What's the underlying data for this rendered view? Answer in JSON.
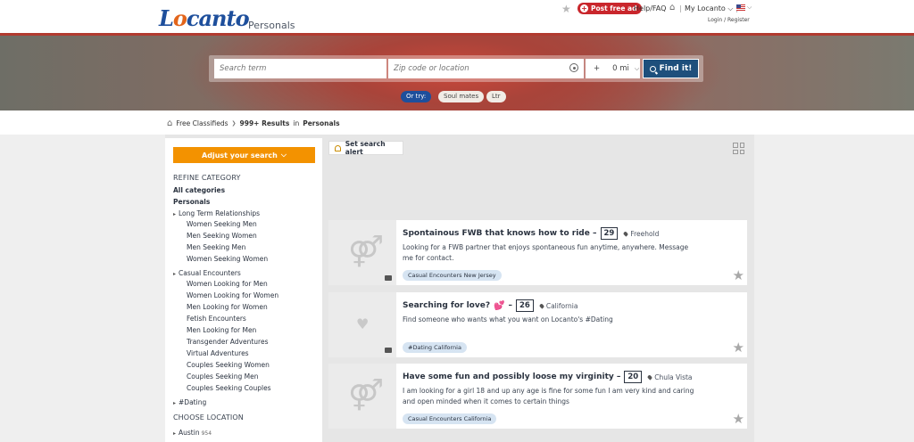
{
  "header": {
    "logo_text_1": "L",
    "logo_text_2": "o",
    "logo_text_3": "canto",
    "section": "Personals",
    "post_free_ad": "Post free ad",
    "help": "Help/FAQ",
    "sep1": "|",
    "sep2": "|",
    "my_locanto": "My Locanto",
    "login_register": "Login / Register"
  },
  "search": {
    "term_placeholder": "Search term",
    "location_placeholder": "Zip code or location",
    "radius_plus": "+",
    "radius_value": "0 mi",
    "find_label": "Find it!",
    "or_try": "Or try:",
    "suggestions": [
      "Soul mates",
      "Ltr"
    ]
  },
  "breadcrumb": {
    "home": "Free Classifieds",
    "arrow": "❯",
    "count": "999+ Results",
    "in": "in",
    "section": "Personals"
  },
  "sidebar": {
    "adjust": "Adjust your search",
    "refine_heading": "REFINE CATEGORY",
    "all_categories": "All categories",
    "current": "Personals",
    "cat1": "Long Term Relationships",
    "cat1_subs": [
      "Women Seeking Men",
      "Men Seeking Women",
      "Men Seeking Men",
      "Women Seeking Women"
    ],
    "cat2": "Casual Encounters",
    "cat2_subs": [
      "Women Looking for Men",
      "Women Looking for Women",
      "Men Looking for Women",
      "Fetish Encounters",
      "Men Looking for Men",
      "Transgender Adventures",
      "Virtual Adventures",
      "Couples Seeking Women",
      "Couples Seeking Men",
      "Couples Seeking Couples"
    ],
    "cat3": "#Dating",
    "location_heading": "CHOOSE LOCATION",
    "city": "Austin",
    "city_count": "954"
  },
  "results": {
    "set_alert": "Set search alert",
    "ads": [
      {
        "title": "Spontainous FWB that knows how to ride –",
        "age": "29",
        "location": "Freehold",
        "desc": "Looking for a FWB partner that enjoys spontaneous fun anytime, anywhere. Message me for contact.",
        "tag": "Casual Encounters New Jersey"
      },
      {
        "title": "Searching for love?",
        "title_emoji": "💕",
        "dash": "–",
        "age": "26",
        "location": "California",
        "desc": "Find someone who wants what you want on Locanto's #Dating",
        "tag": "#Dating California"
      },
      {
        "title": "Have some fun and possibly loose my virginity –",
        "age": "20",
        "location": "Chula Vista",
        "desc": "I am looking for a girl 18 and up any age is fine for some fun I am very kind and caring and open minded when it comes to certain things",
        "tag": "Casual Encounters California"
      }
    ]
  },
  "colors": {
    "brand_blue": "#1e4f9c",
    "brand_orange": "#e2651b",
    "post_red": "#c9262c",
    "adjust_orange": "#f39200",
    "find_navy": "#1e4f7c",
    "tag_bg": "#d6e4f2"
  },
  "icons": [
    "star-icon",
    "plus-icon",
    "home-icon",
    "flag-icon",
    "location-target-icon",
    "search-icon",
    "bell-icon",
    "grid-view-icon",
    "gender-icon",
    "heart-icon",
    "camera-icon",
    "pin-icon",
    "favorite-star-icon"
  ]
}
